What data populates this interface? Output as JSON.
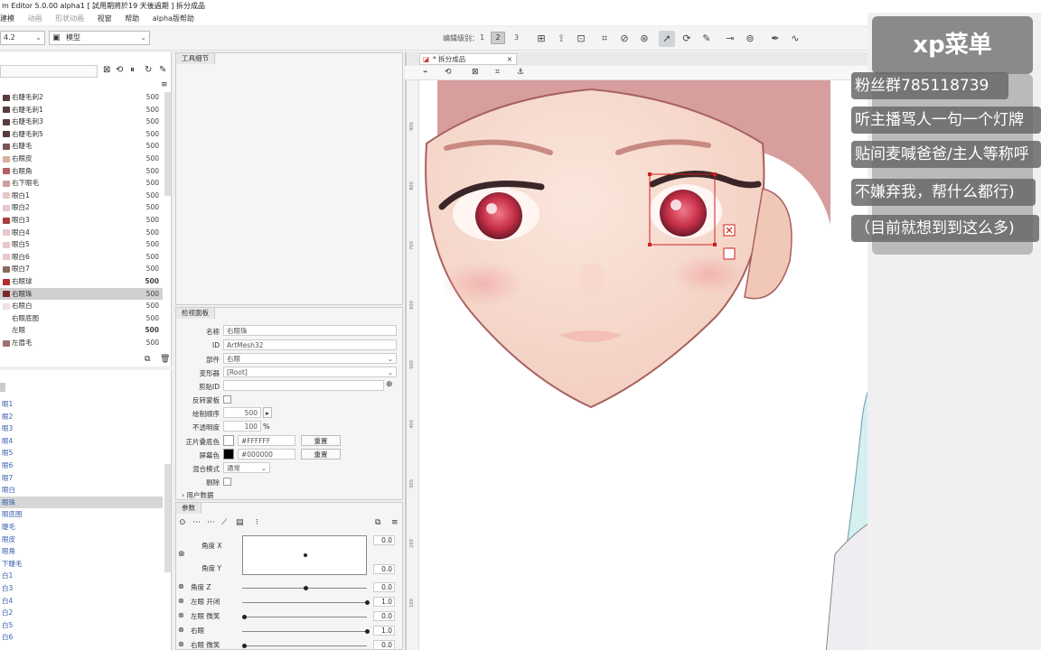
{
  "window": {
    "title": "m Editor 5.0.00 alpha1  [ 試用期將於19 天後過期 ]  拆分成品"
  },
  "menu": [
    "建模",
    "动画",
    "形状动画",
    "视窗",
    "帮助",
    "alpha版帮助"
  ],
  "menu_first_partial": " ",
  "toolbar": {
    "dropdown1": "4.2",
    "dropdown2": "模型",
    "edit_level_label": "编辑级别：",
    "levels": [
      "1",
      "2",
      "3"
    ],
    "active_level": "2"
  },
  "layers": [
    {
      "name": "右睫毛刺2",
      "value": "500",
      "color": "#5a3a3a"
    },
    {
      "name": "右睫毛刺1",
      "value": "500",
      "color": "#5a3a3a"
    },
    {
      "name": "右睫毛刺3",
      "value": "500",
      "color": "#5a3a3a"
    },
    {
      "name": "右睫毛刺5",
      "value": "500",
      "color": "#5a3a3a"
    },
    {
      "name": "右睫毛",
      "value": "500",
      "color": "#7a5555"
    },
    {
      "name": "右眼皮",
      "value": "500",
      "color": "#d8b0a0"
    },
    {
      "name": "右眼角",
      "value": "500",
      "color": "#b06060"
    },
    {
      "name": "右下眼毛",
      "value": "500",
      "color": "#c8a0a0"
    },
    {
      "name": "眼白1",
      "value": "500",
      "color": "#e8c8c8"
    },
    {
      "name": "眼白2",
      "value": "500",
      "color": "#e8c8c8"
    },
    {
      "name": "眼白3",
      "value": "500",
      "color": "#a84040"
    },
    {
      "name": "眼白4",
      "value": "500",
      "color": "#e8c8c8"
    },
    {
      "name": "眼白5",
      "value": "500",
      "color": "#e8c8c8"
    },
    {
      "name": "眼白6",
      "value": "500",
      "color": "#e8c8c8"
    },
    {
      "name": "眼白7",
      "value": "500",
      "color": "#8a6a5a"
    },
    {
      "name": "右眼球",
      "value": "500",
      "color": "#b03030",
      "bold": true
    },
    {
      "name": "右眼珠",
      "value": "500",
      "color": "#7a2a2a",
      "selected": true
    },
    {
      "name": "右眼白",
      "value": "500",
      "color": "#f0e0e0"
    },
    {
      "name": "右眼底图",
      "value": "500",
      "color": "#ffffff"
    },
    {
      "name": "左眼",
      "value": "500",
      "color": "#ffffff",
      "bold": true
    },
    {
      "name": "左眉毛",
      "value": "500",
      "color": "#a07070"
    }
  ],
  "params_list": [
    "眼1",
    "眼2",
    "眼3",
    "眼4",
    "眼5",
    "眼6",
    "眼7",
    "眼白",
    "眼珠",
    "眼底图",
    "睫毛",
    "眼皮",
    "眼角",
    "下睫毛",
    "白1",
    "白3",
    "白4",
    "白2",
    "白5",
    "白6"
  ],
  "params_list_selected": 8,
  "tool_detail": {
    "tab": "工具细节"
  },
  "inspector": {
    "tab": "检视面板",
    "name_label": "名称",
    "name_value": "右眼珠",
    "id_label": "ID",
    "id_value": "ArtMesh32",
    "part_label": "部件",
    "part_value": "右眼",
    "deformer_label": "变形器",
    "deformer_value": "[Root]",
    "clip_label": "剪贴ID",
    "clip_value": "",
    "invert_label": "反转蒙板",
    "draw_order_label": "绘制顺序",
    "draw_order_value": "500",
    "opacity_label": "不透明度",
    "opacity_value": "100",
    "opacity_unit": "%",
    "multiply_label": "正片叠底色",
    "multiply_value": "#FFFFFF",
    "multiply_btn": "重置",
    "screen_label": "屏幕色",
    "screen_value": "#000000",
    "screen_btn": "重置",
    "blend_label": "混合模式",
    "blend_value": "通常",
    "cull_label": "剔除",
    "user_data_label": "用户数据"
  },
  "params_panel": {
    "tab": "参数",
    "angle_x": "角度 X",
    "angle_x_val": "0.0",
    "angle_y": "角度 Y",
    "angle_y_val": "0.0",
    "angle_z": "角度 Z",
    "angle_z_val": "0.0",
    "left_eye_open": "左眼  开闭",
    "left_eye_open_val": "1.0",
    "left_eye_smile": "左眼  微笑",
    "left_eye_smile_val": "0.0",
    "right_eye": "右眼",
    "right_eye_val": "1.0",
    "right_eye_smile": "右眼  微笑",
    "right_eye_smile_val": "0.0",
    "angle_z_pos": 0.5,
    "left_eye_open_pos": 1.0,
    "left_eye_smile_pos": 0.0,
    "right_eye_pos": 1.0,
    "right_eye_smile_pos": 0.0
  },
  "canvas": {
    "tab_label": "* 拆分成品",
    "ruler": [
      "900",
      "800",
      "700",
      "600",
      "500",
      "400",
      "300",
      "200",
      "100"
    ]
  },
  "overlay": {
    "title": "xp菜单",
    "lines": [
      "粉丝群785118739",
      "听主播骂人一句一个灯牌",
      "贴间麦喊爸爸/主人等称呼",
      "不嫌弃我，帮什么都行)",
      "（目前就想到到这么多)"
    ]
  }
}
